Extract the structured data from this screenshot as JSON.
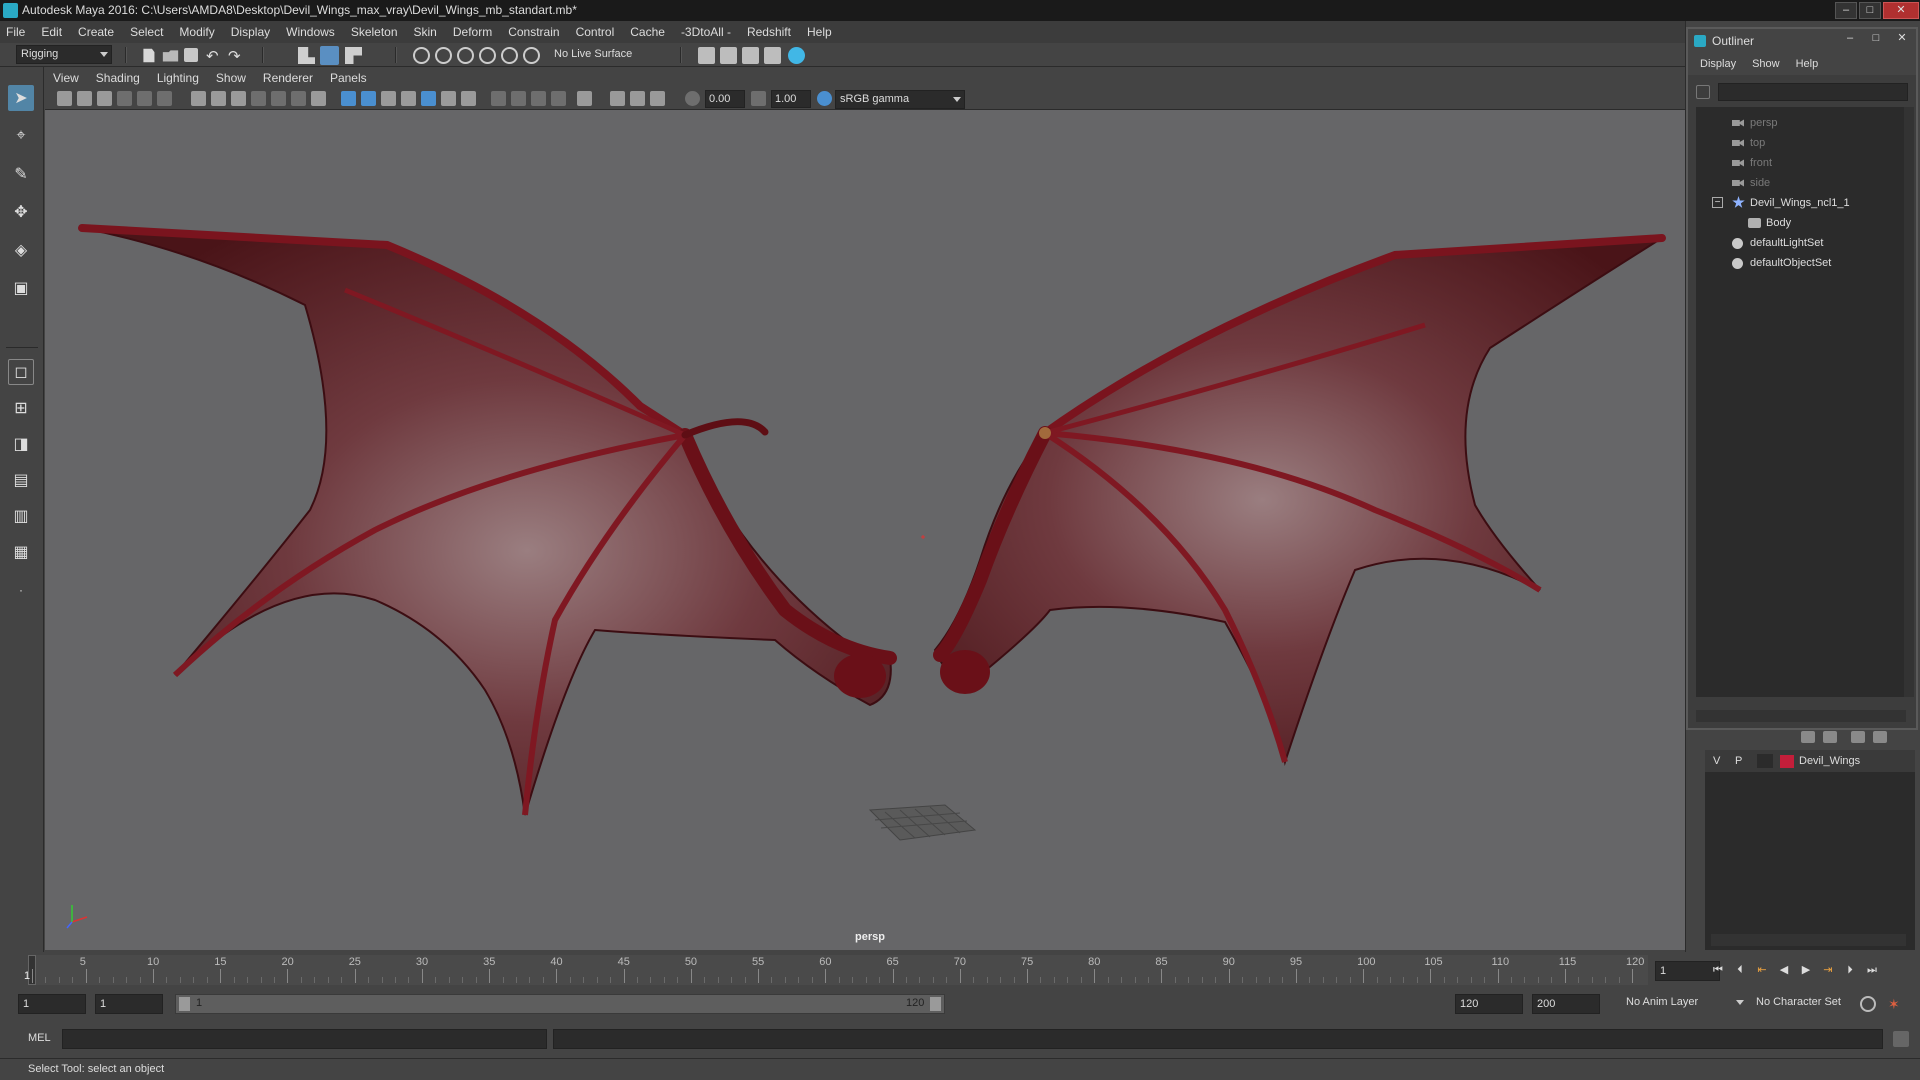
{
  "window": {
    "title": "Autodesk Maya 2016: C:\\Users\\AMDA8\\Desktop\\Devil_Wings_max_vray\\Devil_Wings_mb_standart.mb*"
  },
  "menubar": [
    "File",
    "Edit",
    "Create",
    "Select",
    "Modify",
    "Display",
    "Windows",
    "Skeleton",
    "Skin",
    "Deform",
    "Constrain",
    "Control",
    "Cache",
    "-3DtoAll -",
    "Redshift",
    "Help"
  ],
  "statusline": {
    "menuset": "Rigging",
    "live_surface": "No Live Surface"
  },
  "panel": {
    "menus": [
      "View",
      "Shading",
      "Lighting",
      "Show",
      "Renderer",
      "Panels"
    ],
    "exposure": "0.00",
    "gamma": "1.00",
    "color_space": "sRGB gamma",
    "camera_label": "persp"
  },
  "outliner": {
    "title": "Outliner",
    "menus": [
      "Display",
      "Show",
      "Help"
    ],
    "items": [
      {
        "label": "persp",
        "icon": "camera-icon",
        "dim": true
      },
      {
        "label": "top",
        "icon": "camera-icon",
        "dim": true
      },
      {
        "label": "front",
        "icon": "camera-icon",
        "dim": true
      },
      {
        "label": "side",
        "icon": "camera-icon",
        "dim": true
      },
      {
        "label": "Devil_Wings_ncl1_1",
        "icon": "group-icon",
        "dim": false,
        "expander": "−"
      },
      {
        "label": "Body",
        "icon": "mesh-icon",
        "dim": false
      },
      {
        "label": "defaultLightSet",
        "icon": "set-icon",
        "dim": false
      },
      {
        "label": "defaultObjectSet",
        "icon": "set-icon",
        "dim": false
      }
    ]
  },
  "layers": {
    "rows": [
      {
        "v": "V",
        "p": "P",
        "name": "Devil_Wings",
        "color": "#c41e3a"
      }
    ]
  },
  "timeslider": {
    "ticks": [
      "1",
      "5",
      "10",
      "15",
      "20",
      "25",
      "30",
      "35",
      "40",
      "45",
      "50",
      "55",
      "60",
      "65",
      "70",
      "75",
      "80",
      "85",
      "90",
      "95",
      "100",
      "105",
      "110",
      "115",
      "120"
    ],
    "current_frame": "1"
  },
  "range": {
    "start": "1",
    "playback_start": "1",
    "bar_start": "1",
    "bar_end": "120",
    "playback_end": "120",
    "end": "200",
    "anim_layer": "No Anim Layer",
    "character_set": "No Character Set"
  },
  "cmdline": {
    "language": "MEL"
  },
  "helpline": {
    "text": "Select Tool: select an object"
  },
  "colors": {
    "viewport_bg": "#666668",
    "wing_red": "#8a1a22",
    "selection_blue": "#5285a6"
  }
}
